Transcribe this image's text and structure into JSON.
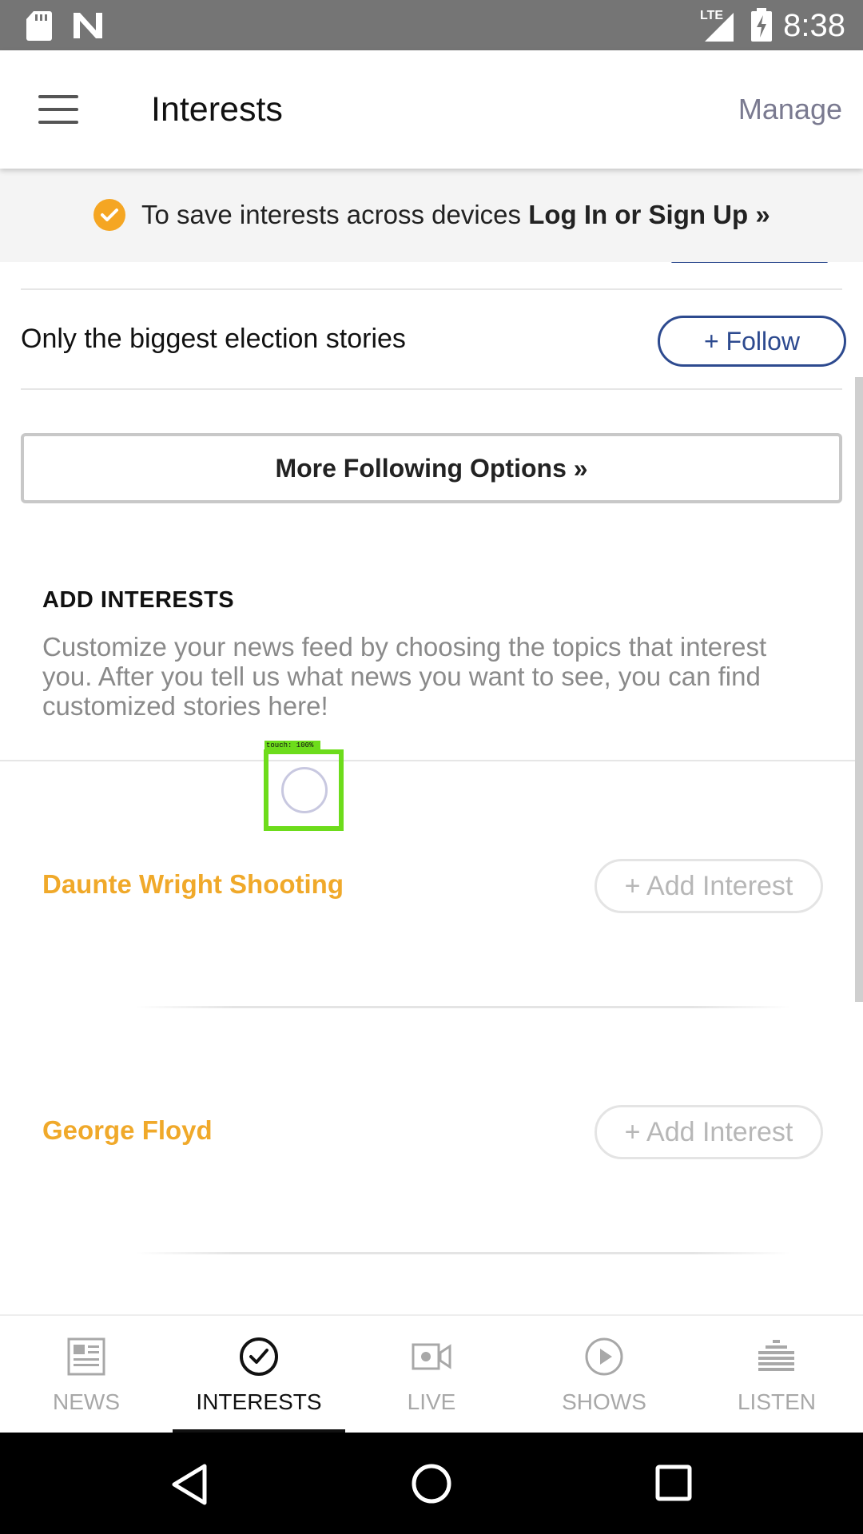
{
  "status_bar": {
    "time": "8:38",
    "network_label": "LTE",
    "icons": [
      "sd-card-icon",
      "n-notification-icon",
      "signal-icon",
      "battery-charging-icon"
    ]
  },
  "app_bar": {
    "title": "Interests",
    "manage_label": "Manage",
    "menu_icon": "hamburger-menu-icon"
  },
  "banner": {
    "text": "To save interests across devices ",
    "link": "Log In or Sign Up »",
    "accent": "#f5a623"
  },
  "following_row": {
    "label": "Only the biggest election stories",
    "button": "+ Follow"
  },
  "more_options": {
    "label": "More Following Options »"
  },
  "add_interests": {
    "heading": "ADD INTERESTS",
    "description": "Customize your news feed by choosing the topics that interest you. After you tell us what news you want to see, you can find customized stories here!",
    "items": [
      {
        "name": "Daunte Wright Shooting",
        "button": "+ Add Interest"
      },
      {
        "name": "George Floyd",
        "button": "+ Add Interest"
      }
    ]
  },
  "touch_overlay": {
    "label": "touch: 100%"
  },
  "tabs": [
    {
      "label": "NEWS",
      "icon": "newspaper-icon",
      "active": false
    },
    {
      "label": "INTERESTS",
      "icon": "check-circle-icon",
      "active": true
    },
    {
      "label": "LIVE",
      "icon": "video-camera-icon",
      "active": false
    },
    {
      "label": "SHOWS",
      "icon": "play-circle-icon",
      "active": false
    },
    {
      "label": "LISTEN",
      "icon": "equalizer-icon",
      "active": false
    }
  ],
  "colors": {
    "accent_orange": "#f0a92a",
    "follow_blue": "#2d4a8f"
  }
}
